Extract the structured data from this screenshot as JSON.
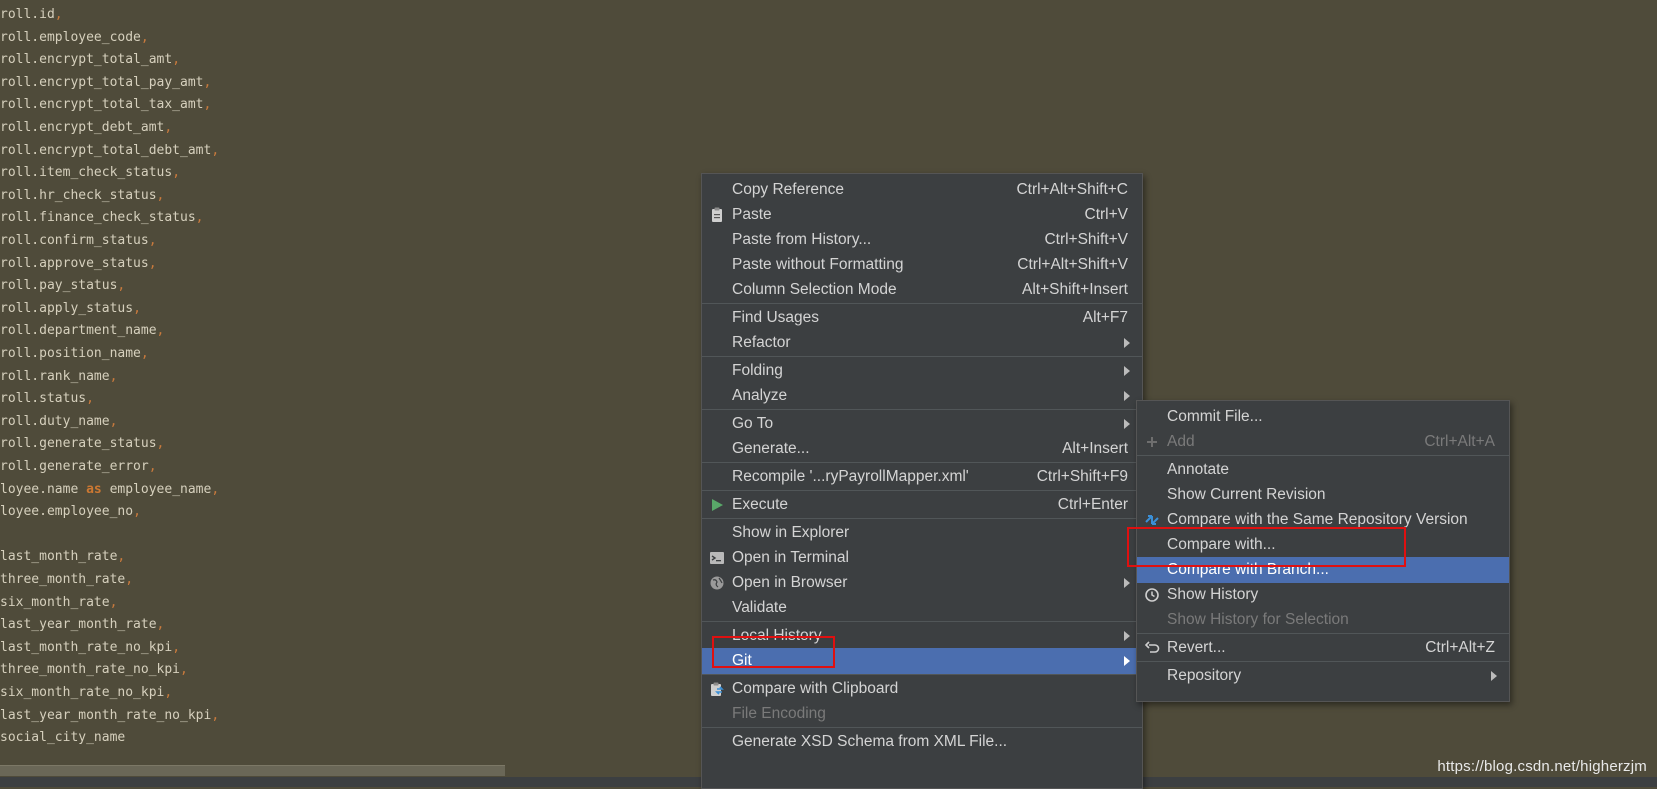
{
  "editor": {
    "lines": [
      {
        "text": "roll.id",
        "suffix": ","
      },
      {
        "text": "roll.employee_code",
        "suffix": ","
      },
      {
        "text": "roll.encrypt_total_amt",
        "suffix": ","
      },
      {
        "text": "roll.encrypt_total_pay_amt",
        "suffix": ","
      },
      {
        "text": "roll.encrypt_total_tax_amt",
        "suffix": ","
      },
      {
        "text": "roll.encrypt_debt_amt",
        "suffix": ","
      },
      {
        "text": "roll.encrypt_total_debt_amt",
        "suffix": ","
      },
      {
        "text": "roll.item_check_status",
        "suffix": ","
      },
      {
        "text": "roll.hr_check_status",
        "suffix": ","
      },
      {
        "text": "roll.finance_check_status",
        "suffix": ","
      },
      {
        "text": "roll.confirm_status",
        "suffix": ","
      },
      {
        "text": "roll.approve_status",
        "suffix": ","
      },
      {
        "text": "roll.pay_status",
        "suffix": ","
      },
      {
        "text": "roll.apply_status",
        "suffix": ","
      },
      {
        "text": "roll.department_name",
        "suffix": ","
      },
      {
        "text": "roll.position_name",
        "suffix": ","
      },
      {
        "text": "roll.rank_name",
        "suffix": ","
      },
      {
        "text": "roll.status",
        "suffix": ","
      },
      {
        "text": "roll.duty_name",
        "suffix": ","
      },
      {
        "text": "roll.generate_status",
        "suffix": ","
      },
      {
        "text": "roll.generate_error",
        "suffix": ","
      },
      {
        "text": "loyee.name ",
        "keyword": "as",
        "after": " employee_name",
        "suffix": ","
      },
      {
        "text": "loyee.employee_no",
        "suffix": ","
      },
      {
        "text": "",
        "suffix": ""
      },
      {
        "text": "last_month_rate",
        "suffix": ","
      },
      {
        "text": "three_month_rate",
        "suffix": ","
      },
      {
        "text": "six_month_rate",
        "suffix": ","
      },
      {
        "text": "last_year_month_rate",
        "suffix": ","
      },
      {
        "text": "last_month_rate_no_kpi",
        "suffix": ","
      },
      {
        "text": "three_month_rate_no_kpi",
        "suffix": ","
      },
      {
        "text": "six_month_rate_no_kpi",
        "suffix": ","
      },
      {
        "text": "last_year_month_rate_no_kpi",
        "suffix": ","
      },
      {
        "text": "social_city_name",
        "suffix": ""
      }
    ]
  },
  "context_menu": {
    "items": [
      {
        "label": "Copy Reference",
        "shortcut": "Ctrl+Alt+Shift+C"
      },
      {
        "label": "Paste",
        "shortcut": "Ctrl+V",
        "icon": "clipboard-icon"
      },
      {
        "label": "Paste from History...",
        "shortcut": "Ctrl+Shift+V"
      },
      {
        "label": "Paste without Formatting",
        "shortcut": "Ctrl+Alt+Shift+V"
      },
      {
        "label": "Column Selection Mode",
        "shortcut": "Alt+Shift+Insert"
      },
      {
        "separator": true
      },
      {
        "label": "Find Usages",
        "shortcut": "Alt+F7"
      },
      {
        "label": "Refactor",
        "submenu": true
      },
      {
        "separator": true
      },
      {
        "label": "Folding",
        "submenu": true
      },
      {
        "label": "Analyze",
        "submenu": true
      },
      {
        "separator": true
      },
      {
        "label": "Go To",
        "submenu": true
      },
      {
        "label": "Generate...",
        "shortcut": "Alt+Insert"
      },
      {
        "separator": true
      },
      {
        "label": "Recompile '...ryPayrollMapper.xml'",
        "shortcut": "Ctrl+Shift+F9"
      },
      {
        "separator": true
      },
      {
        "label": "Execute",
        "shortcut": "Ctrl+Enter",
        "icon": "run-icon"
      },
      {
        "separator": true
      },
      {
        "label": "Show in Explorer"
      },
      {
        "label": "Open in Terminal",
        "icon": "terminal-icon"
      },
      {
        "label": "Open in Browser",
        "submenu": true,
        "icon": "globe-icon"
      },
      {
        "label": "Validate"
      },
      {
        "separator": true
      },
      {
        "label": "Local History",
        "submenu": true
      },
      {
        "label": "Git",
        "submenu": true,
        "selected": true
      },
      {
        "separator": true
      },
      {
        "label": "Compare with Clipboard",
        "icon": "compare-clipboard-icon"
      },
      {
        "label": "File Encoding",
        "disabled": true
      },
      {
        "separator": true
      },
      {
        "label": "Generate XSD Schema from XML File..."
      }
    ]
  },
  "git_submenu": {
    "items": [
      {
        "label": "Commit File..."
      },
      {
        "label": "Add",
        "shortcut": "Ctrl+Alt+A",
        "disabled": true,
        "icon": "plus-icon"
      },
      {
        "separator": true
      },
      {
        "label": "Annotate"
      },
      {
        "label": "Show Current Revision"
      },
      {
        "label": "Compare with the Same Repository Version",
        "icon": "compare-arrows-icon"
      },
      {
        "label": "Compare with..."
      },
      {
        "label": "Compare with Branch...",
        "selected": true
      },
      {
        "label": "Show History",
        "icon": "clock-icon"
      },
      {
        "label": "Show History for Selection",
        "disabled": true
      },
      {
        "separator": true
      },
      {
        "label": "Revert...",
        "shortcut": "Ctrl+Alt+Z",
        "icon": "revert-icon"
      },
      {
        "separator": true
      },
      {
        "label": "Repository",
        "submenu": true
      }
    ]
  },
  "watermark": "https://blog.csdn.net/higherzjm",
  "colors": {
    "editor_bg": "#4f4b3a",
    "menu_bg": "#3c3f41",
    "selection": "#4b6eaf",
    "highlight_box": "#e01010",
    "keyword": "#cc7832"
  }
}
